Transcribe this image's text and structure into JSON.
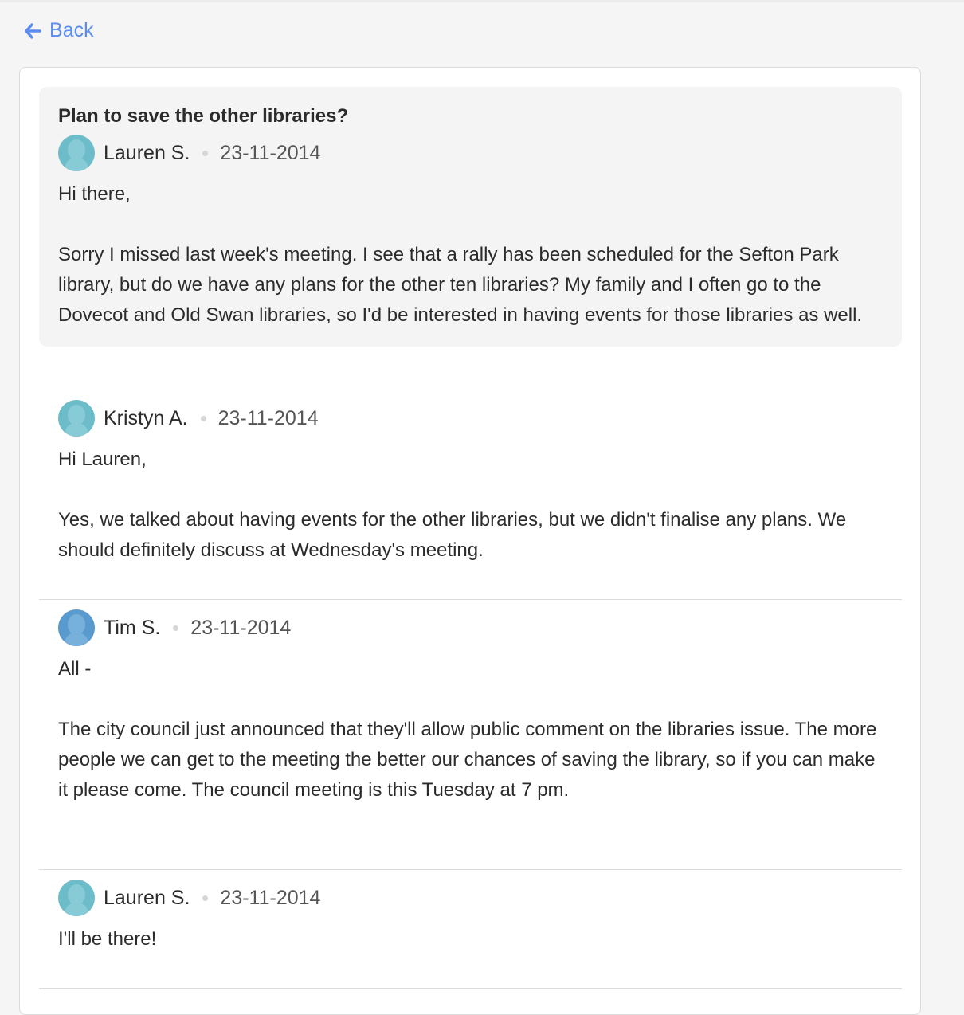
{
  "nav": {
    "back_label": "Back"
  },
  "thread": {
    "title": "Plan to save the other libraries?",
    "original": {
      "author": "Lauren S.",
      "date": "23-11-2014",
      "paragraphs": [
        "Hi there,",
        "Sorry I missed last week's meeting. I see that a rally has been scheduled for the Sefton Park library, but do we have any plans for the other ten libraries? My family and I often go to the Dovecot and Old Swan libraries, so I'd be interested in having events for those libraries as well."
      ]
    },
    "replies": [
      {
        "author": "Kristyn A.",
        "date": "23-11-2014",
        "paragraphs": [
          "Hi Lauren,",
          "Yes, we talked about having events for the other libraries, but we didn't finalise any plans. We should definitely discuss at Wednesday's meeting."
        ]
      },
      {
        "author": "Tim S.",
        "date": "23-11-2014",
        "paragraphs": [
          "All -",
          "The city council just announced that they'll allow public comment on the libraries issue. The more people we can get to the meeting the better our chances of saving the library, so if you can make it please come. The council meeting is this Tuesday at 7 pm."
        ]
      },
      {
        "author": "Lauren S.",
        "date": "23-11-2014",
        "paragraphs": [
          "I'll be there!"
        ]
      }
    ]
  },
  "colors": {
    "accent": "#5b8def",
    "avatar_teal": "#6cbdc9",
    "avatar_blue": "#5a9bcf",
    "highlight_bg": "#f4f4f4"
  },
  "icons": {
    "back": "arrow-left-icon",
    "avatar": "user-silhouette-icon"
  }
}
